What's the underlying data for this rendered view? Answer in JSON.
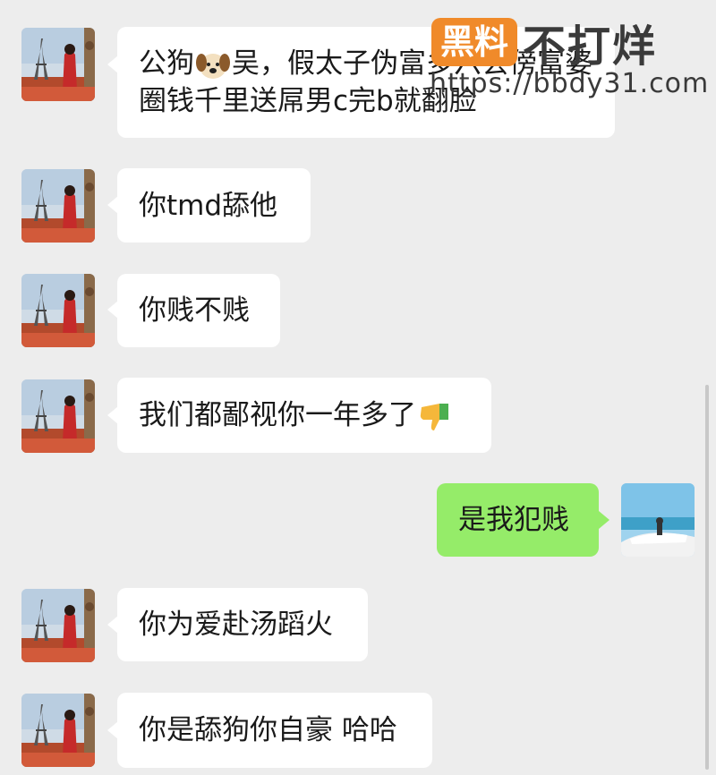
{
  "watermark": {
    "badge": "黑料",
    "text": "不打烊",
    "url": "https://bbdy31.com"
  },
  "messages": [
    {
      "from": "them",
      "text_a": "公狗",
      "emoji": "dog-face",
      "text_b": "吴，假太子伪富多六会傍富婆圈钱千里送屌男c完b就翻脸"
    },
    {
      "from": "them",
      "text": "你tmd舔他"
    },
    {
      "from": "them",
      "text": "你贱不贱"
    },
    {
      "from": "them",
      "text": "我们都鄙视你一年多了",
      "emoji": "thumbs-down"
    },
    {
      "from": "me",
      "text": "是我犯贱"
    },
    {
      "from": "them",
      "text": "你为爱赴汤蹈火"
    },
    {
      "from": "them",
      "text": "你是舔狗你自豪 哈哈"
    }
  ],
  "colors": {
    "background": "#ededed",
    "incoming_bubble": "#ffffff",
    "outgoing_bubble": "#95ec69",
    "watermark_badge": "#f08a2a"
  }
}
